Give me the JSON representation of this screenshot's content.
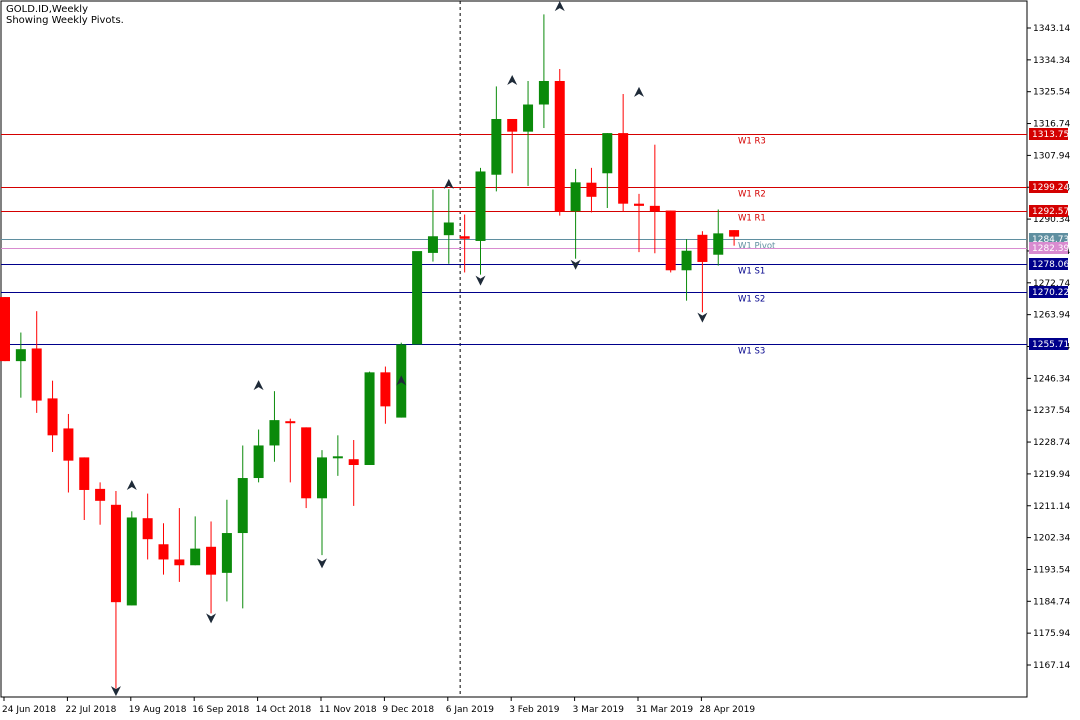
{
  "header": {
    "title": "GOLD.ID,Weekly",
    "subtitle": "Showing Weekly Pivots."
  },
  "colors": {
    "bull": "#0a8a0a",
    "bear": "#ff0000",
    "resistance": "#d40000",
    "support": "#00008b",
    "pivot": "#5f8fa0",
    "pivot_alt": "#d98bd0"
  },
  "chart_data": {
    "type": "candlestick",
    "title": "GOLD.ID,Weekly",
    "ylim": [
      1160,
      1350
    ],
    "y_ticks": [
      "1343.14",
      "1334.34",
      "1325.54",
      "1316.74",
      "1307.94",
      "1299.14",
      "1290.34",
      "1281.54",
      "1272.74",
      "1263.94",
      "1255.14",
      "1246.34",
      "1237.54",
      "1228.74",
      "1219.94",
      "1211.14",
      "1202.34",
      "1193.54",
      "1184.74",
      "1175.94",
      "1167.14"
    ],
    "x_labels": [
      "24 Jun 2018",
      "22 Jul 2018",
      "19 Aug 2018",
      "16 Sep 2018",
      "14 Oct 2018",
      "11 Nov 2018",
      "9 Dec 2018",
      "6 Jan 2019",
      "3 Feb 2019",
      "3 Mar 2019",
      "31 Mar 2019",
      "28 Apr 2019"
    ],
    "candles": [
      {
        "o": 1268.8,
        "h": 1268.8,
        "l": 1251.1,
        "c": 1251.1
      },
      {
        "o": 1251.1,
        "h": 1259.0,
        "l": 1241.0,
        "c": 1254.4
      },
      {
        "o": 1254.6,
        "h": 1264.9,
        "l": 1236.8,
        "c": 1240.2
      },
      {
        "o": 1240.8,
        "h": 1245.7,
        "l": 1226.0,
        "c": 1230.6
      },
      {
        "o": 1232.5,
        "h": 1236.5,
        "l": 1214.8,
        "c": 1223.6
      },
      {
        "o": 1224.5,
        "h": 1224.5,
        "l": 1207.2,
        "c": 1215.5
      },
      {
        "o": 1215.8,
        "h": 1217.6,
        "l": 1205.9,
        "c": 1212.5
      },
      {
        "o": 1211.4,
        "h": 1215.2,
        "l": 1160.6,
        "c": 1184.5
      },
      {
        "o": 1183.6,
        "h": 1209.6,
        "l": 1183.6,
        "c": 1207.9
      },
      {
        "o": 1207.7,
        "h": 1214.5,
        "l": 1196.3,
        "c": 1201.9
      },
      {
        "o": 1200.5,
        "h": 1206.3,
        "l": 1192.1,
        "c": 1196.3
      },
      {
        "o": 1196.3,
        "h": 1210.5,
        "l": 1190.1,
        "c": 1194.7
      },
      {
        "o": 1194.7,
        "h": 1208.2,
        "l": 1194.7,
        "c": 1199.3
      },
      {
        "o": 1199.8,
        "h": 1206.8,
        "l": 1181.4,
        "c": 1192.1
      },
      {
        "o": 1192.6,
        "h": 1212.8,
        "l": 1184.7,
        "c": 1203.6
      },
      {
        "o": 1203.6,
        "h": 1227.8,
        "l": 1182.8,
        "c": 1218.8
      },
      {
        "o": 1218.8,
        "h": 1232.2,
        "l": 1217.6,
        "c": 1227.8
      },
      {
        "o": 1227.8,
        "h": 1242.8,
        "l": 1223.3,
        "c": 1234.8
      },
      {
        "o": 1234.5,
        "h": 1235.2,
        "l": 1217.6,
        "c": 1234.0
      },
      {
        "o": 1232.8,
        "h": 1232.8,
        "l": 1210.5,
        "c": 1213.2
      },
      {
        "o": 1213.2,
        "h": 1226.5,
        "l": 1197.5,
        "c": 1224.5
      },
      {
        "o": 1224.4,
        "h": 1230.6,
        "l": 1219.4,
        "c": 1224.8
      },
      {
        "o": 1224.0,
        "h": 1229.3,
        "l": 1211.1,
        "c": 1222.4
      },
      {
        "o": 1222.4,
        "h": 1248.2,
        "l": 1222.4,
        "c": 1248.0
      },
      {
        "o": 1248.0,
        "h": 1249.6,
        "l": 1233.8,
        "c": 1238.6
      },
      {
        "o": 1235.5,
        "h": 1256.2,
        "l": 1235.5,
        "c": 1255.7
      },
      {
        "o": 1255.7,
        "h": 1263.9,
        "l": 1255.7,
        "c": 1281.5
      },
      {
        "o": 1281.0,
        "h": 1298.5,
        "l": 1278.6,
        "c": 1285.6
      },
      {
        "o": 1285.9,
        "h": 1298.6,
        "l": 1278.0,
        "c": 1289.4
      },
      {
        "o": 1285.6,
        "h": 1291.6,
        "l": 1275.6,
        "c": 1284.9
      },
      {
        "o": 1284.3,
        "h": 1304.5,
        "l": 1275.0,
        "c": 1303.5
      },
      {
        "o": 1302.6,
        "h": 1327.0,
        "l": 1298.0,
        "c": 1318.0
      },
      {
        "o": 1318.0,
        "h": 1318.0,
        "l": 1303.0,
        "c": 1314.5
      },
      {
        "o": 1314.5,
        "h": 1328.5,
        "l": 1299.5,
        "c": 1322.0
      },
      {
        "o": 1322.0,
        "h": 1346.9,
        "l": 1315.5,
        "c": 1328.5
      },
      {
        "o": 1328.5,
        "h": 1331.8,
        "l": 1291.3,
        "c": 1292.5
      },
      {
        "o": 1292.5,
        "h": 1304.2,
        "l": 1279.4,
        "c": 1300.5
      },
      {
        "o": 1300.4,
        "h": 1304.5,
        "l": 1292.2,
        "c": 1296.5
      },
      {
        "o": 1303.0,
        "h": 1314.1,
        "l": 1293.4,
        "c": 1314.1
      },
      {
        "o": 1314.1,
        "h": 1324.9,
        "l": 1292.4,
        "c": 1294.6
      },
      {
        "o": 1294.6,
        "h": 1297.3,
        "l": 1281.2,
        "c": 1294.0
      },
      {
        "o": 1294.0,
        "h": 1310.9,
        "l": 1280.9,
        "c": 1292.5
      },
      {
        "o": 1292.7,
        "h": 1292.7,
        "l": 1275.6,
        "c": 1276.2
      },
      {
        "o": 1276.2,
        "h": 1284.8,
        "l": 1267.8,
        "c": 1281.6
      },
      {
        "o": 1286.0,
        "h": 1287.0,
        "l": 1264.6,
        "c": 1278.5
      },
      {
        "o": 1280.5,
        "h": 1293.0,
        "l": 1277.5,
        "c": 1286.4
      },
      {
        "o": 1287.3,
        "h": 1287.3,
        "l": 1283.0,
        "c": 1285.5
      }
    ],
    "fractals_up": [
      {
        "i": 16,
        "y": 1244.2
      },
      {
        "i": 8,
        "y": 1216.6
      },
      {
        "i": 25,
        "y": 1245.5
      },
      {
        "i": 28,
        "y": 1299.8
      },
      {
        "i": 32,
        "y": 1328.5
      },
      {
        "i": 35,
        "y": 1348.9
      },
      {
        "i": 40,
        "y": 1325.2
      }
    ],
    "fractals_down": [
      {
        "i": 7,
        "y": 1160.2
      },
      {
        "i": 13,
        "y": 1180.3
      },
      {
        "i": 20,
        "y": 1195.5
      },
      {
        "i": 30,
        "y": 1273.6
      },
      {
        "i": 36,
        "y": 1278.0
      },
      {
        "i": 44,
        "y": 1263.4
      }
    ],
    "cursor_index": 29,
    "levels": [
      {
        "name": "W1 R3",
        "value": 1313.75,
        "label": "1313.75",
        "role": "resistance"
      },
      {
        "name": "W1 R2",
        "value": 1299.24,
        "label": "1299.24",
        "role": "resistance"
      },
      {
        "name": "W1 R1",
        "value": 1292.57,
        "label": "1292.57",
        "role": "resistance"
      },
      {
        "name": "W1 Pivot",
        "value": 1284.73,
        "label": "1284.73",
        "role": "pivot"
      },
      {
        "name": "",
        "value": 1282.39,
        "label": "1282.39",
        "role": "pivot_alt"
      },
      {
        "name": "W1 S1",
        "value": 1278.06,
        "label": "1278.06",
        "role": "support"
      },
      {
        "name": "W1 S2",
        "value": 1270.22,
        "label": "1270.22",
        "role": "support"
      },
      {
        "name": "W1 S3",
        "value": 1255.71,
        "label": "1255.71",
        "role": "support"
      }
    ]
  }
}
